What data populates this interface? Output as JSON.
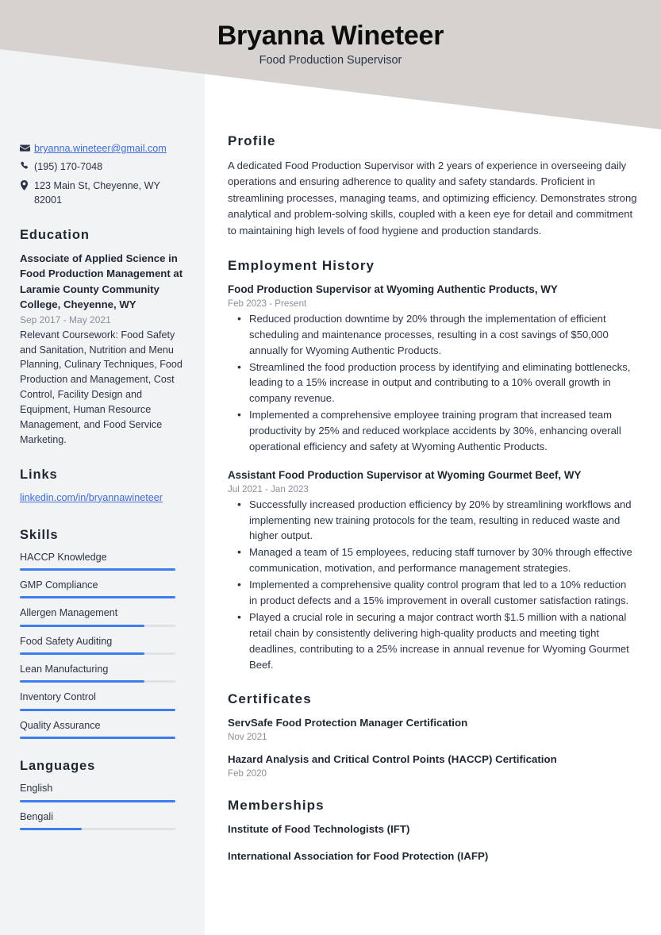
{
  "header": {
    "name": "Bryanna Wineteer",
    "job_title": "Food Production Supervisor",
    "band_color": "#d6d2cf"
  },
  "theme": {
    "accent_color": "#3d7bf0",
    "link_color": "#3d6ce0",
    "sidebar_bg": "#f2f3f5",
    "heading_color": "#1f2733",
    "muted_color": "#8a8f99"
  },
  "sidebar": {
    "contact": [
      {
        "icon": "envelope-icon",
        "value": "bryanna.wineteer@gmail.com",
        "is_link": true
      },
      {
        "icon": "phone-icon",
        "value": "(195) 170-7048",
        "is_link": false
      },
      {
        "icon": "location-pin-icon",
        "value": "123 Main St, Cheyenne, WY 82001",
        "is_link": false
      }
    ],
    "education": {
      "heading": "Education",
      "degree": "Associate of Applied Science in Food Production Management at Laramie County Community College, Cheyenne, WY",
      "dates": "Sep 2017 - May 2021",
      "description": "Relevant Coursework: Food Safety and Sanitation, Nutrition and Menu Planning, Culinary Techniques, Food Production and Management, Cost Control, Facility Design and Equipment, Human Resource Management, and Food Service Marketing."
    },
    "links": {
      "heading": "Links",
      "items": [
        {
          "label": "linkedin.com/in/bryannawineteer"
        }
      ]
    },
    "skills": {
      "heading": "Skills",
      "items": [
        {
          "label": "HACCP Knowledge",
          "level": 100
        },
        {
          "label": "GMP Compliance",
          "level": 100
        },
        {
          "label": "Allergen Management",
          "level": 80
        },
        {
          "label": "Food Safety Auditing",
          "level": 80
        },
        {
          "label": "Lean Manufacturing",
          "level": 80
        },
        {
          "label": "Inventory Control",
          "level": 100
        },
        {
          "label": "Quality Assurance",
          "level": 100
        }
      ]
    },
    "languages": {
      "heading": "Languages",
      "items": [
        {
          "label": "English",
          "level": 100
        },
        {
          "label": "Bengali",
          "level": 40
        }
      ]
    }
  },
  "main": {
    "profile": {
      "heading": "Profile",
      "text": "A dedicated Food Production Supervisor with 2 years of experience in overseeing daily operations and ensuring adherence to quality and safety standards. Proficient in streamlining processes, managing teams, and optimizing efficiency. Demonstrates strong analytical and problem-solving skills, coupled with a keen eye for detail and commitment to maintaining high levels of food hygiene and production standards."
    },
    "employment": {
      "heading": "Employment History",
      "jobs": [
        {
          "title": "Food Production Supervisor at Wyoming Authentic Products, WY",
          "dates": "Feb 2023 - Present",
          "bullets": [
            "Reduced production downtime by 20% through the implementation of efficient scheduling and maintenance processes, resulting in a cost savings of $50,000 annually for Wyoming Authentic Products.",
            "Streamlined the food production process by identifying and eliminating bottlenecks, leading to a 15% increase in output and contributing to a 10% overall growth in company revenue.",
            "Implemented a comprehensive employee training program that increased team productivity by 25% and reduced workplace accidents by 30%, enhancing overall operational efficiency and safety at Wyoming Authentic Products."
          ]
        },
        {
          "title": "Assistant Food Production Supervisor at Wyoming Gourmet Beef, WY",
          "dates": "Jul 2021 - Jan 2023",
          "bullets": [
            "Successfully increased production efficiency by 20% by streamlining workflows and implementing new training protocols for the team, resulting in reduced waste and higher output.",
            "Managed a team of 15 employees, reducing staff turnover by 30% through effective communication, motivation, and performance management strategies.",
            "Implemented a comprehensive quality control program that led to a 10% reduction in product defects and a 15% improvement in overall customer satisfaction ratings.",
            "Played a crucial role in securing a major contract worth $1.5 million with a national retail chain by consistently delivering high-quality products and meeting tight deadlines, contributing to a 25% increase in annual revenue for Wyoming Gourmet Beef."
          ]
        }
      ]
    },
    "certificates": {
      "heading": "Certificates",
      "items": [
        {
          "name": "ServSafe Food Protection Manager Certification",
          "date": "Nov 2021"
        },
        {
          "name": "Hazard Analysis and Critical Control Points (HACCP) Certification",
          "date": "Feb 2020"
        }
      ]
    },
    "memberships": {
      "heading": "Memberships",
      "items": [
        {
          "name": "Institute of Food Technologists (IFT)"
        },
        {
          "name": "International Association for Food Protection (IAFP)"
        }
      ]
    }
  }
}
